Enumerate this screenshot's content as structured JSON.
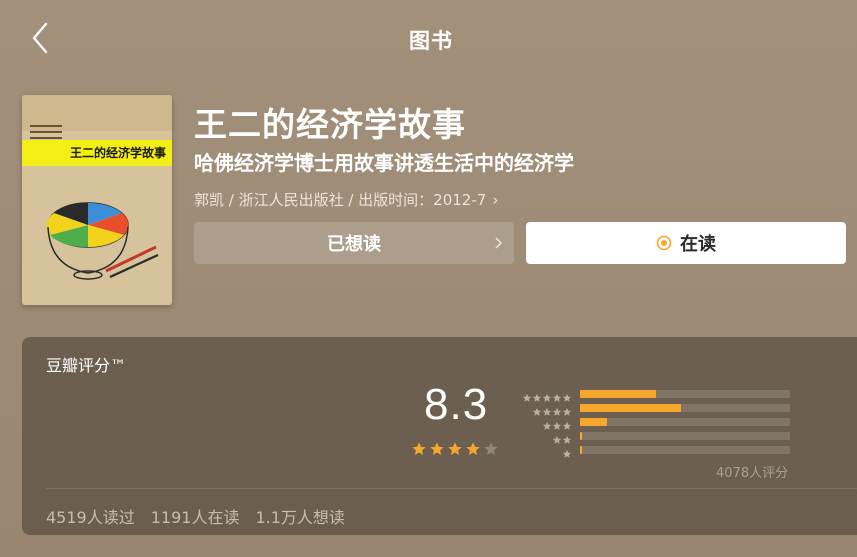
{
  "header": {
    "title": "图书"
  },
  "book": {
    "title": "王二的经济学故事",
    "subtitle": "哈佛经济学博士用故事讲透生活中的经济学",
    "meta": "郭凯 / 浙江人民出版社 / 出版时间：2012-7",
    "cover_title": "王二的经济学故事"
  },
  "actions": {
    "want_label": "已想读",
    "reading_label": "在读"
  },
  "rating": {
    "label": "豆瓣评分™",
    "score": "8.3",
    "stars_filled": 4,
    "distribution": [
      {
        "stars": 5,
        "percent": 36
      },
      {
        "stars": 4,
        "percent": 48
      },
      {
        "stars": 3,
        "percent": 13
      },
      {
        "stars": 2,
        "percent": 1
      },
      {
        "stars": 1,
        "percent": 1
      }
    ],
    "count_text": "4078人评分"
  },
  "stats": {
    "read": "4519人读过",
    "reading": "1191人在读",
    "want": "1.1万人想读"
  },
  "colors": {
    "accent": "#f6a82e",
    "background": "#a2907a",
    "card": "#5a4e40"
  }
}
